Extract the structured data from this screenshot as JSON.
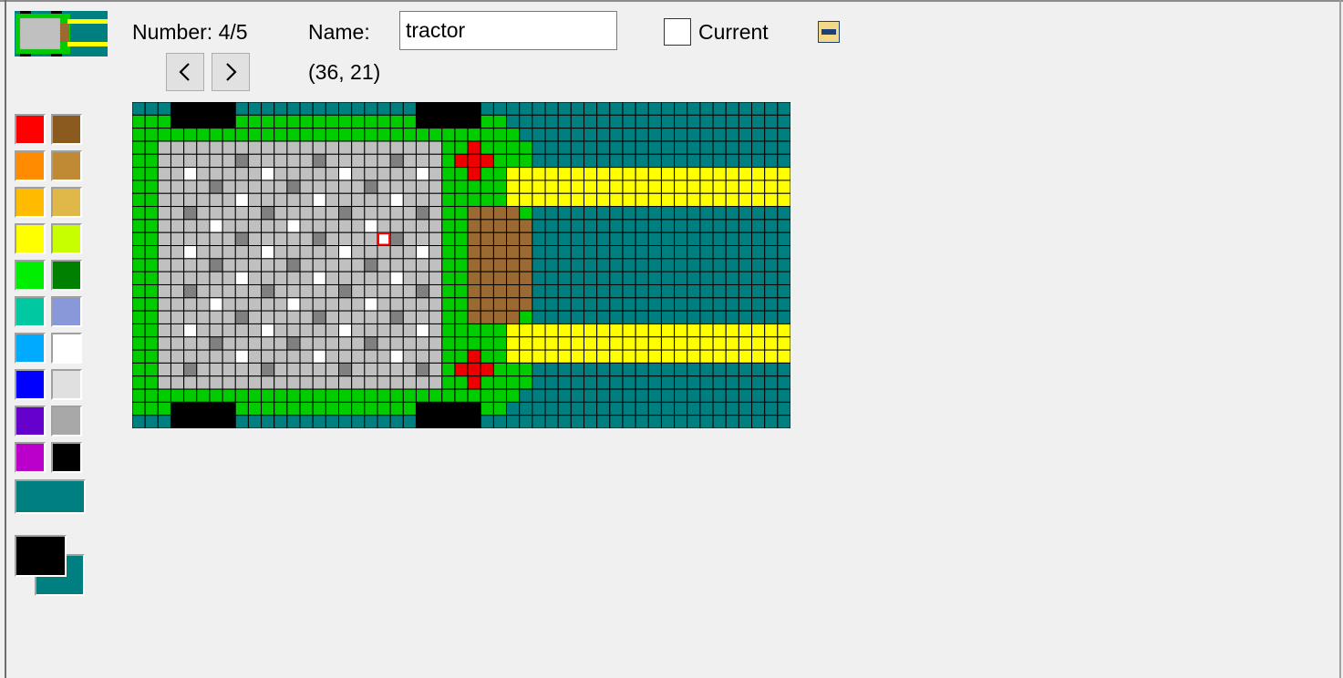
{
  "window": {
    "frame": "editor"
  },
  "header": {
    "number_label": "Number: 4/5",
    "name_label": "Name:",
    "name_value": "tractor",
    "current_label": "Current",
    "current_checked": false,
    "coordinates": "(36, 21)",
    "prev_icon": "chevron-left-icon",
    "next_icon": "chevron-right-icon",
    "minimize_icon": "minus-box-icon"
  },
  "palette": {
    "colors": [
      [
        "#ff0000",
        "#8b5a1e"
      ],
      [
        "#ff8c00",
        "#c08a34"
      ],
      [
        "#ffbb00",
        "#e0b84a"
      ],
      [
        "#ffff00",
        "#c8ff00"
      ],
      [
        "#00ee00",
        "#008000"
      ],
      [
        "#00c8a0",
        "#8898d8"
      ],
      [
        "#00aaff",
        "#ffffff"
      ],
      [
        "#0000ff",
        "#e0e0e0"
      ],
      [
        "#6600cc",
        "#a8a8a8"
      ],
      [
        "#bb00cc",
        "#000000"
      ]
    ],
    "transparent_color": "#007f80",
    "foreground_color": "#000000",
    "background_color": "#007f80"
  },
  "sprite": {
    "selected_cell": [
      19,
      10
    ],
    "colors": {
      "teal": "#007f80",
      "green": "#00cc00",
      "gray": "#c0c0c0",
      "dark": "#808080",
      "white": "#ffffff",
      "yellow": "#ffff00",
      "brown": "#9b6a32",
      "red": "#ee0000",
      "black": "#000000",
      "grid_line": "#000000",
      "selection": "#ff0000"
    }
  }
}
